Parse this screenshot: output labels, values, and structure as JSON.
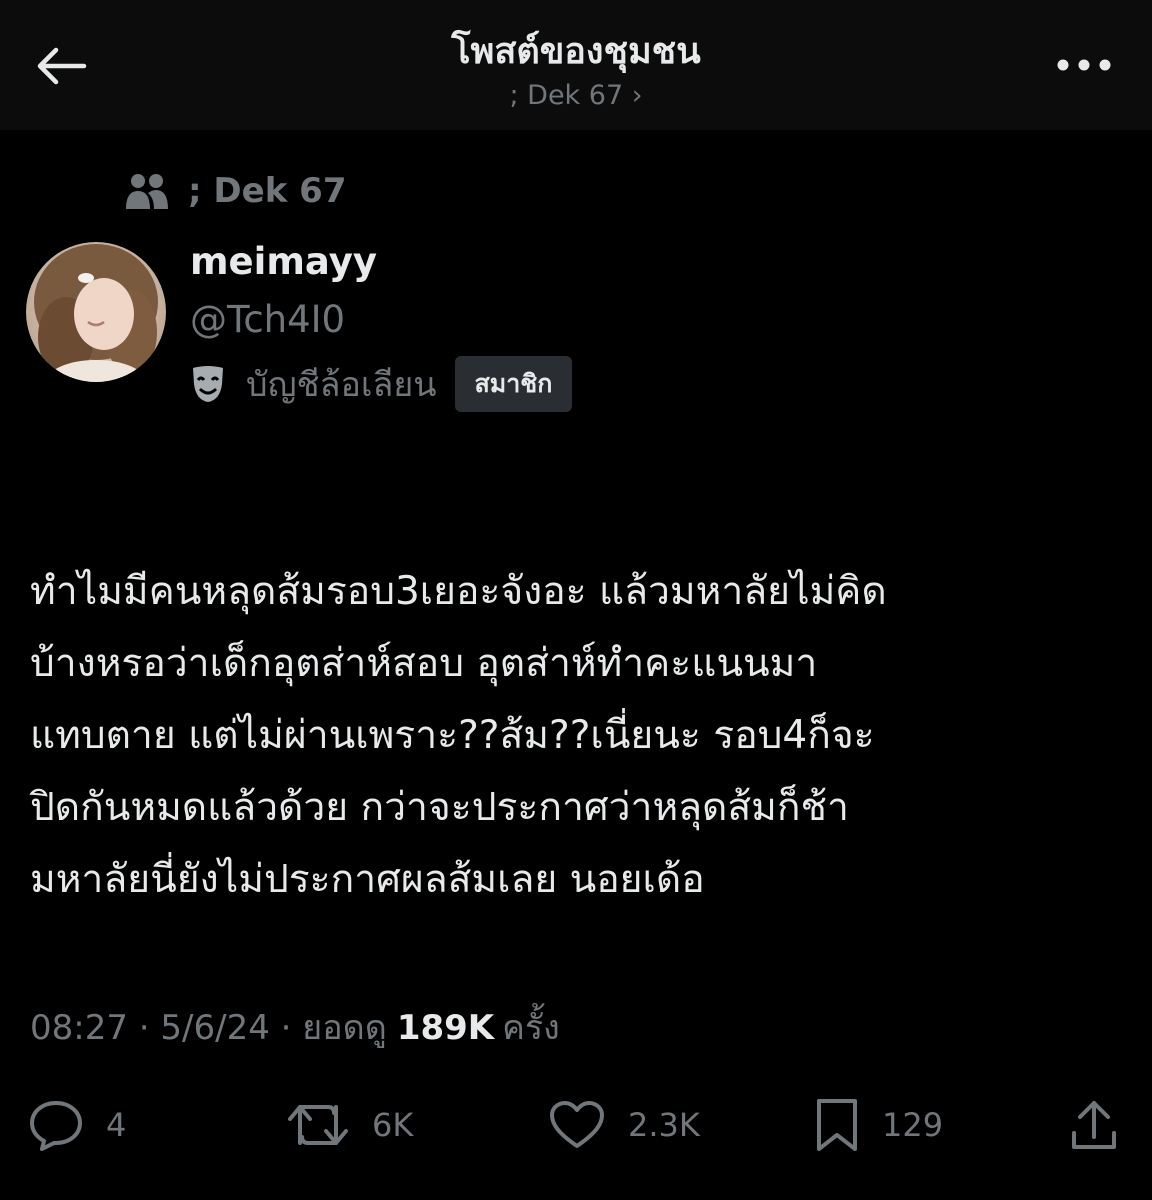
{
  "header": {
    "title": "โพสต์ของชุมชน",
    "subtitle": "; Dek 67 ›",
    "back_icon": "arrow-left-icon",
    "more_icon": "more-dots-icon"
  },
  "community": {
    "icon": "community-people-icon",
    "name": "; Dek 67"
  },
  "author": {
    "display_name": "meimayy",
    "handle": "@Tch4I0",
    "parody_icon": "theater-mask-icon",
    "parody_label": "บัญชีล้อเลียน",
    "member_badge": "สมาชิก"
  },
  "post": {
    "text": "ทำไมมีคนหลุดส้มรอบ3เยอะจังอะ แล้วมหาลัยไม่คิด\nบ้างหรอว่าเด็กอุตส่าห์สอบ อุตส่าห์ทำคะแนนมา\nแทบตาย แต่ไม่ผ่านเพราะ??ส้ม??เนี่ยนะ รอบ4ก็จะ\nปิดกันหมดแล้วด้วย กว่าจะประกาศว่าหลุดส้มก็ช้า\nมหาลัยนี่ยังไม่ประกาศผลส้มเลย นอยเด้อ",
    "time": "08:27",
    "date": "5/6/24",
    "views_label": "ยอดดู",
    "views": "189K",
    "views_suffix": "ครั้ง"
  },
  "actions": {
    "reply": {
      "icon": "reply-bubble-icon",
      "count": "4"
    },
    "repost": {
      "icon": "repost-icon",
      "count": "6K"
    },
    "like": {
      "icon": "heart-icon",
      "count": "2.3K"
    },
    "bookmark": {
      "icon": "bookmark-icon",
      "count": "129"
    },
    "share": {
      "icon": "share-icon"
    }
  },
  "colors": {
    "background": "#000000",
    "header_background": "#0c0c0c",
    "text_primary": "#e7e9ea",
    "text_secondary": "#71767b",
    "badge_background": "#2a2d31"
  }
}
